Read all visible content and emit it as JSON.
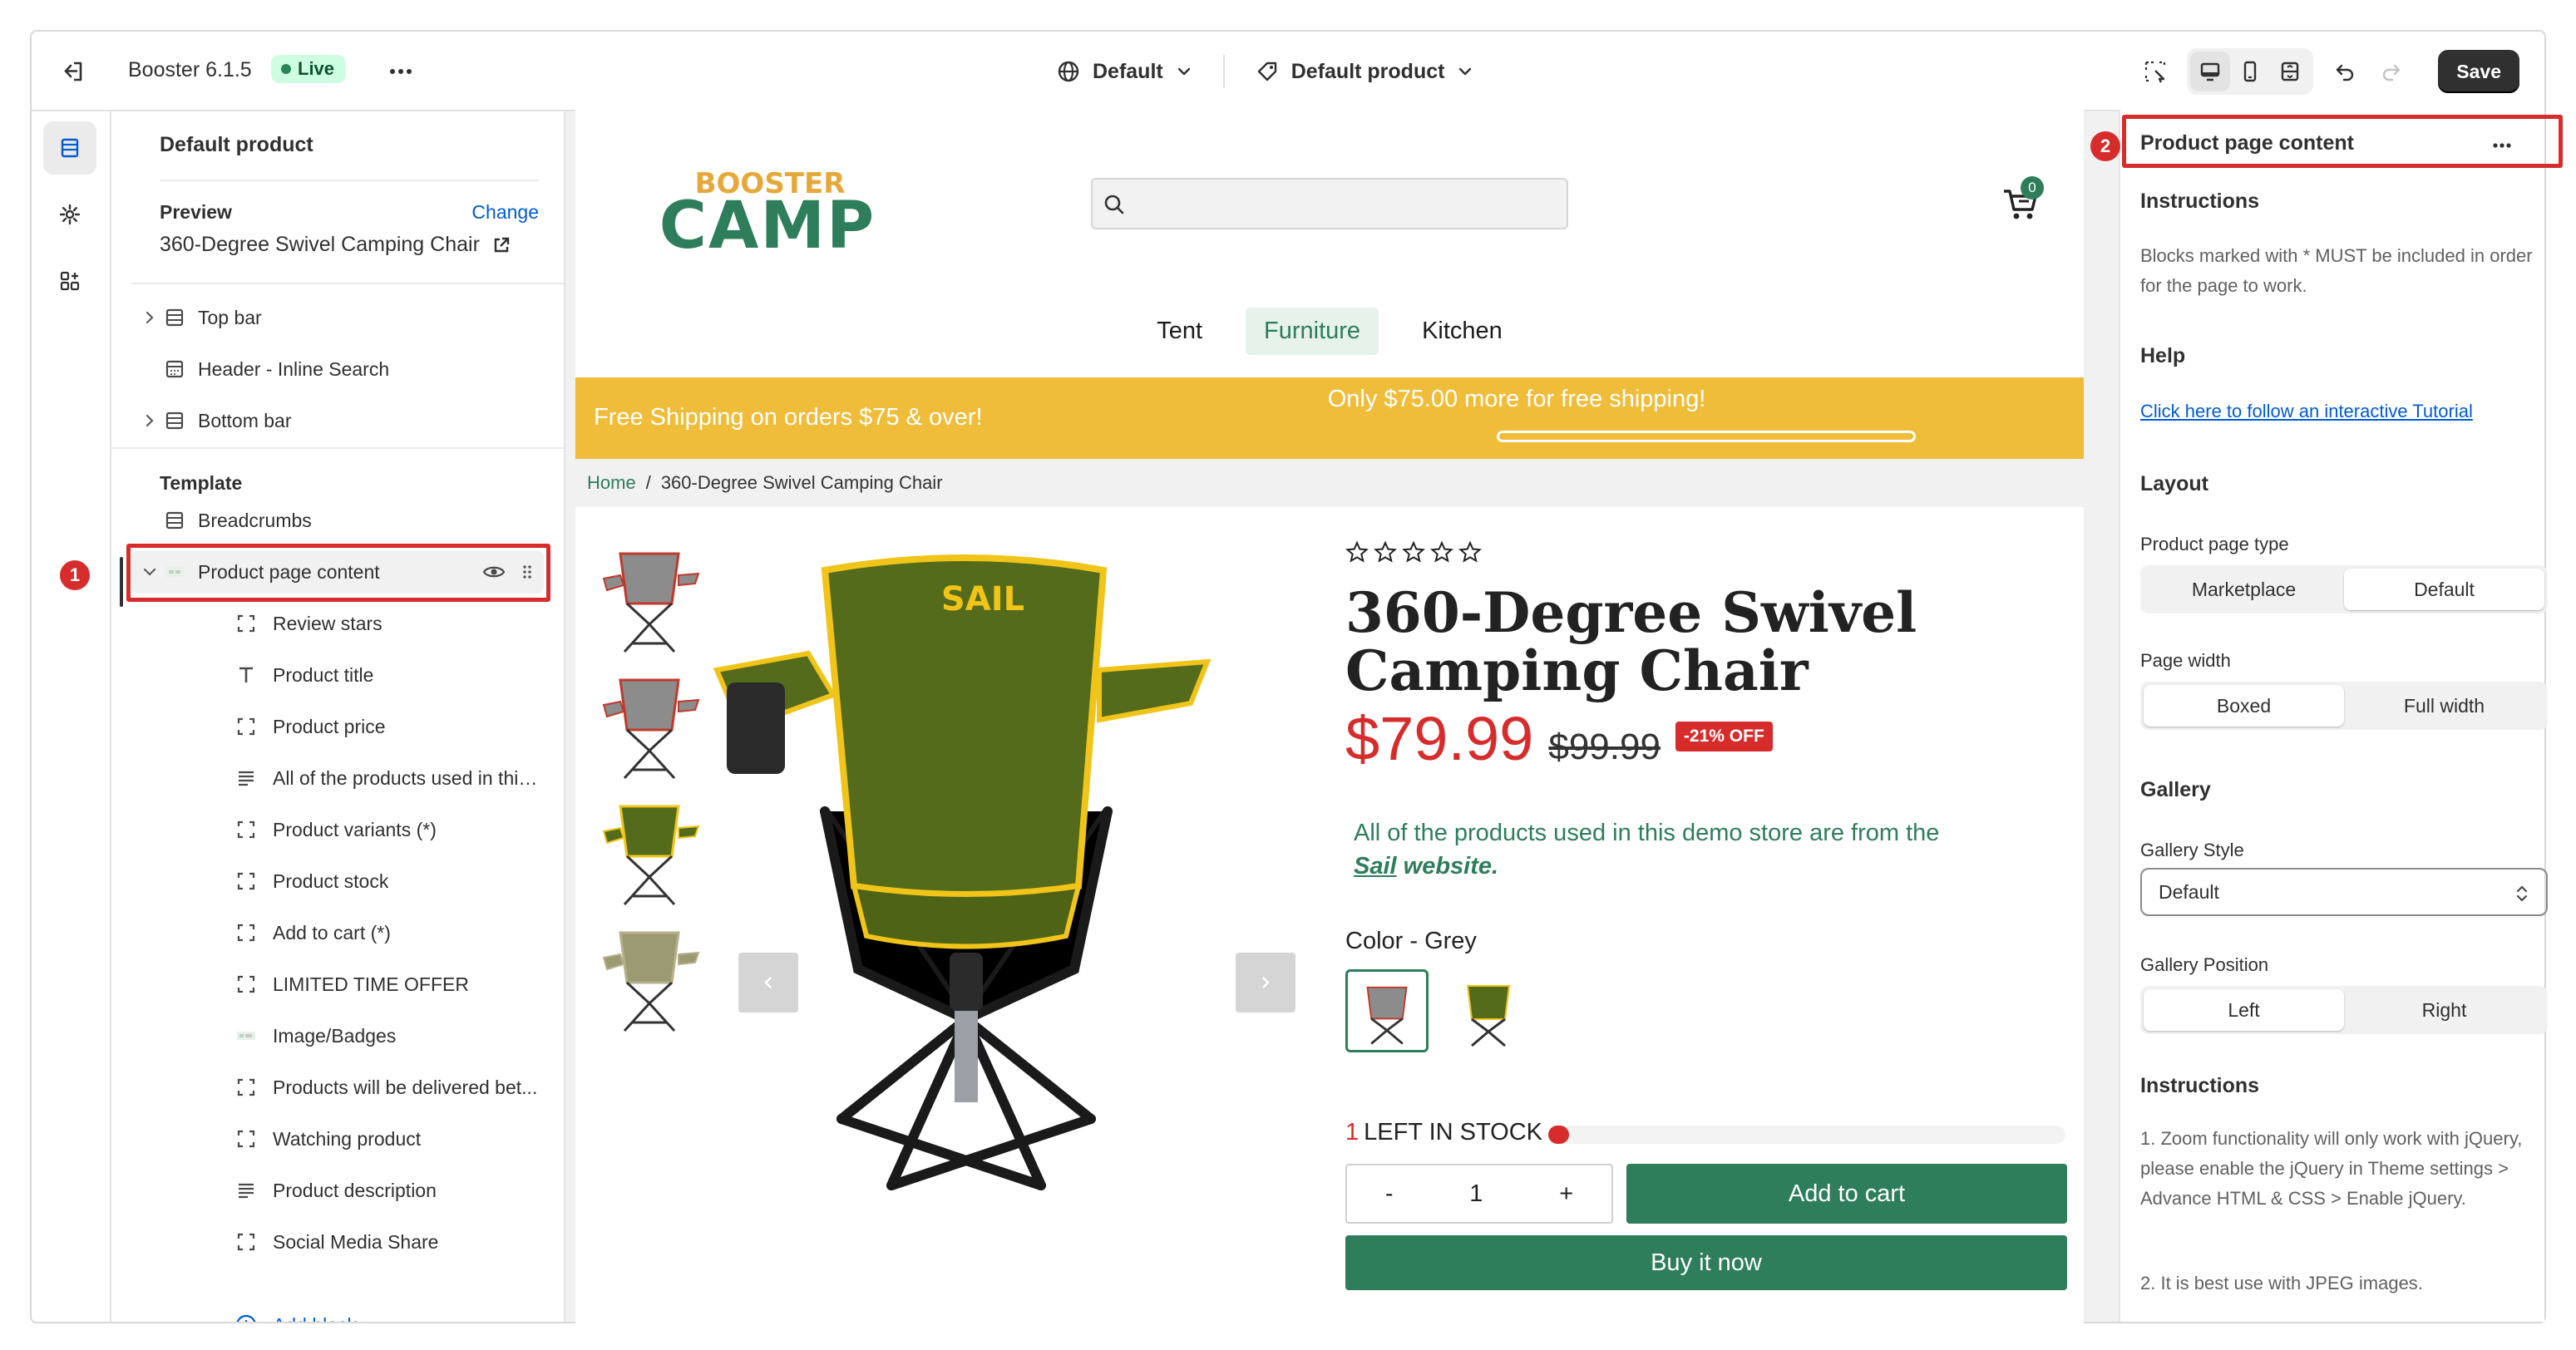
{
  "topbar": {
    "app_name": "Booster 6.1.5",
    "status": "Live",
    "theme_selector": "Default",
    "template_selector": "Default product",
    "save_label": "Save"
  },
  "left_panel": {
    "title": "Default product",
    "preview_label": "Preview",
    "change_label": "Change",
    "preview_value": "360-Degree Swivel Camping Chair",
    "header_sections": [
      "Top bar",
      "Header - Inline Search",
      "Bottom bar"
    ],
    "template_label": "Template",
    "breadcrumbs": "Breadcrumbs",
    "selected_section": "Product page content",
    "blocks": [
      "Review stars",
      "Product title",
      "Product price",
      "All of the products used in this...",
      "Product variants (*)",
      "Product stock",
      "Add to cart (*)",
      "LIMITED TIME OFFER",
      "Image/Badges",
      "Products will be delivered bet...",
      "Watching product",
      "Product description",
      "Social Media Share"
    ],
    "add_block": "Add block",
    "annotation_1": "1"
  },
  "store": {
    "logo_top": "BOOSTER",
    "logo_bottom": "CAMP",
    "cart_count": "0",
    "nav": [
      "Tent",
      "Furniture",
      "Kitchen"
    ],
    "nav_active": "Furniture",
    "promo_left": "Free Shipping on orders $75 & over!",
    "promo_right": "Only $75.00 more for free shipping!",
    "breadcrumb_home": "Home",
    "breadcrumb_sep": "/",
    "breadcrumb_current": "360-Degree Swivel Camping Chair",
    "product_title": "360-Degree Swivel Camping Chair",
    "price": "$79.99",
    "compare_price": "$99.99",
    "discount_badge": "-21% OFF",
    "sail_text_pre": "All of the products used in this demo store are from the ",
    "sail_link": "Sail",
    "sail_text_post": " website.",
    "color_label": "Color - Grey",
    "stock_count": "1",
    "stock_text": "LEFT IN STOCK",
    "stock_level": 0.04,
    "qty_minus": "-",
    "qty_value": "1",
    "qty_plus": "+",
    "add_to_cart": "Add to cart",
    "buy_now": "Buy it now",
    "chair_brand": "SAIL"
  },
  "right_panel": {
    "title": "Product page content",
    "annotation_2": "2",
    "instructions_heading": "Instructions",
    "instructions_text": "Blocks marked with * MUST be included in order for the page to work.",
    "help_heading": "Help",
    "help_link": "Click here to follow an interactive Tutorial",
    "layout_heading": "Layout",
    "page_type_label": "Product page type",
    "page_type_options": [
      "Marketplace",
      "Default"
    ],
    "page_type_selected": "Default",
    "page_width_label": "Page width",
    "page_width_options": [
      "Boxed",
      "Full width"
    ],
    "page_width_selected": "Boxed",
    "gallery_heading": "Gallery",
    "gallery_style_label": "Gallery Style",
    "gallery_style_value": "Default",
    "gallery_position_label": "Gallery Position",
    "gallery_position_options": [
      "Left",
      "Right"
    ],
    "gallery_position_selected": "Left",
    "instructions2_heading": "Instructions",
    "instructions2_p1": "1. Zoom functionality will only work with jQuery, please enable the jQuery in Theme settings > Advance HTML & CSS > Enable jQuery.",
    "instructions2_p2": "2. It is best use with JPEG images."
  },
  "colors": {
    "accent_green": "#2e7d5b",
    "promo_yellow": "#f0bd3a",
    "sale_red": "#d72c2c",
    "highlight_red": "#d72c2c"
  }
}
